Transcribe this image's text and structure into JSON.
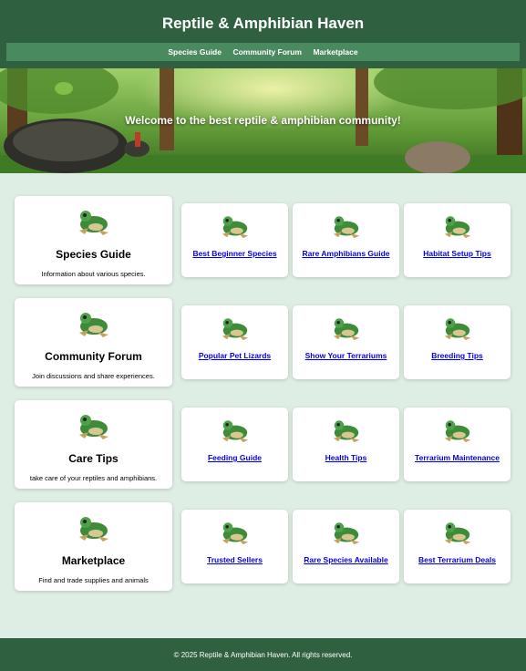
{
  "header": {
    "title": "Reptile & Amphibian Haven",
    "nav": [
      "Species Guide",
      "Community Forum",
      "Marketplace"
    ]
  },
  "hero": {
    "text": "Welcome to the best reptile & amphibian community!"
  },
  "sections": [
    {
      "title": "Species Guide",
      "description": "Information about various species.",
      "links": [
        "Best Beginner Species",
        "Rare Amphibians Guide",
        "Habitat Setup Tips"
      ]
    },
    {
      "title": "Community Forum",
      "description": "Join discussions and share experiences.",
      "links": [
        "Popular Pet Lizards",
        "Show Your Terrariums",
        "Breeding Tips"
      ]
    },
    {
      "title": "Care Tips",
      "description": "take care of your reptiles and amphibians.",
      "links": [
        "Feeding Guide",
        "Health Tips",
        "Terrarium Maintenance"
      ]
    },
    {
      "title": "Marketplace",
      "description": "Find and trade supplies and animals",
      "links": [
        "Trusted Sellers",
        "Rare Species Available",
        "Best Terrarium Deals"
      ]
    }
  ],
  "footer": {
    "text": "© 2025 Reptile & Amphibian Haven. All rights reserved."
  },
  "colors": {
    "header_bg": "#2f6140",
    "nav_bg": "#4a8a5f",
    "page_bg": "#dfeee4",
    "link": "#0000ee"
  },
  "icons": [
    "frog-icon"
  ]
}
